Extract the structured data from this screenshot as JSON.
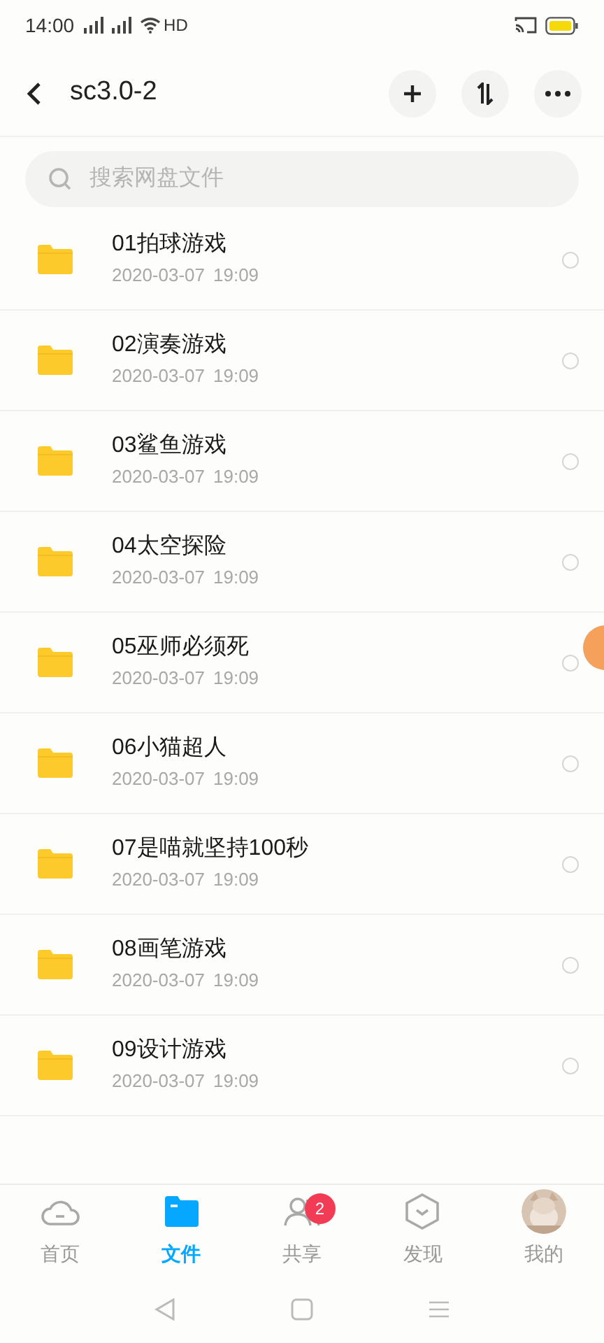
{
  "status_bar": {
    "time": "14:00",
    "network_label": "HD"
  },
  "header": {
    "title": "sc3.0-2"
  },
  "search": {
    "placeholder": "搜索网盘文件"
  },
  "files": [
    {
      "name": "01拍球游戏",
      "date": "2020-03-07",
      "time": "19:09",
      "checked": false
    },
    {
      "name": "02演奏游戏",
      "date": "2020-03-07",
      "time": "19:09",
      "checked": false
    },
    {
      "name": "03鲨鱼游戏",
      "date": "2020-03-07",
      "time": "19:09",
      "checked": false
    },
    {
      "name": "04太空探险",
      "date": "2020-03-07",
      "time": "19:09",
      "checked": false
    },
    {
      "name": "05巫师必须死",
      "date": "2020-03-07",
      "time": "19:09",
      "checked": false
    },
    {
      "name": "06小猫超人",
      "date": "2020-03-07",
      "time": "19:09",
      "checked": false
    },
    {
      "name": "07是喵就坚持100秒",
      "date": "2020-03-07",
      "time": "19:09",
      "checked": false
    },
    {
      "name": "08画笔游戏",
      "date": "2020-03-07",
      "time": "19:09",
      "checked": false
    },
    {
      "name": "09设计游戏",
      "date": "2020-03-07",
      "time": "19:09",
      "checked": false
    }
  ],
  "bottom_nav": [
    {
      "kind": "home",
      "label": "首页",
      "selected": false
    },
    {
      "kind": "files",
      "label": "文件",
      "selected": true
    },
    {
      "kind": "share",
      "label": "共享",
      "selected": false,
      "badge": "2"
    },
    {
      "kind": "discover",
      "label": "发现",
      "selected": false
    },
    {
      "kind": "me",
      "label": "我的",
      "selected": false
    }
  ]
}
